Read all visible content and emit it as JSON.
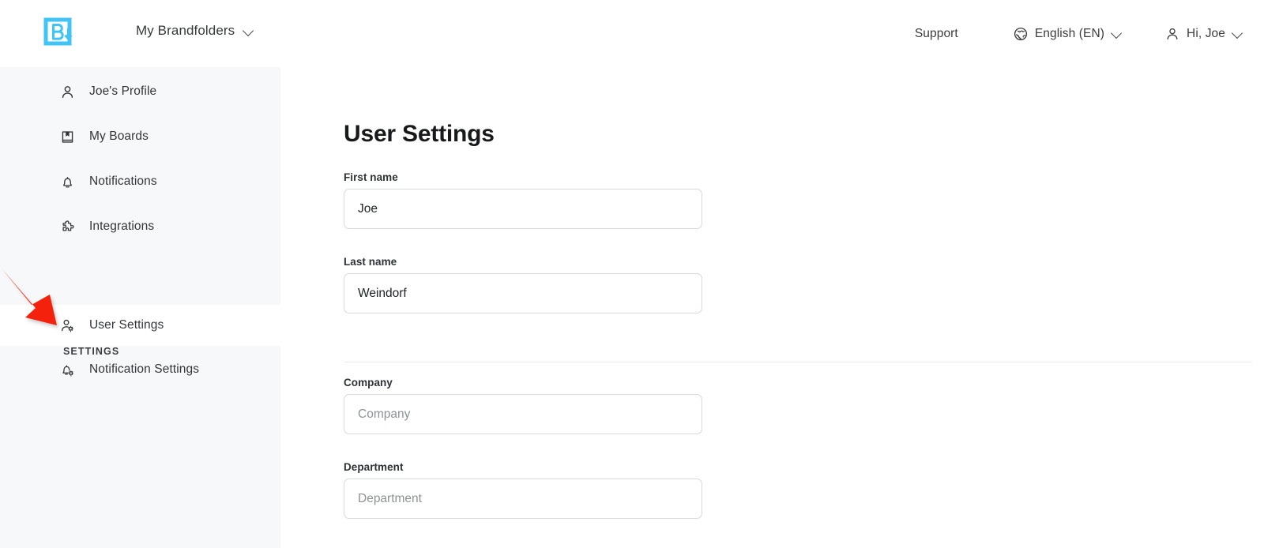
{
  "brand": {
    "logo_icon": "brandfolder-b-logo",
    "logo_color": "#40c4f5"
  },
  "header": {
    "brandfolders_label": "My Brandfolders",
    "brandfolders_caret_icon": "chevron-down-icon",
    "support_label": "Support",
    "language_icon": "globe-icon",
    "language_label": "English (EN)",
    "language_caret_icon": "chevron-down-icon",
    "user_icon": "person-icon",
    "user_label": "Hi, Joe",
    "user_caret_icon": "chevron-down-icon"
  },
  "sidebar": {
    "items": [
      {
        "label": "Joe's Profile",
        "icon": "person-icon",
        "active": false
      },
      {
        "label": "My Boards",
        "icon": "book-bookmark-icon",
        "active": false
      },
      {
        "label": "Notifications",
        "icon": "bell-icon",
        "active": false
      },
      {
        "label": "Integrations",
        "icon": "puzzle-piece-icon",
        "active": false
      }
    ],
    "section_label": "SETTINGS",
    "settings_items": [
      {
        "label": "User Settings",
        "icon": "person-gear-icon",
        "active": true
      },
      {
        "label": "Notification Settings",
        "icon": "bell-gear-icon",
        "active": false
      }
    ],
    "background_color": "#f7f8fa",
    "active_background_color": "#ffffff"
  },
  "main": {
    "page_title": "User Settings",
    "fields": [
      {
        "label": "First name",
        "value": "Joe",
        "placeholder": "",
        "is_placeholder": false
      },
      {
        "label": "Last name",
        "value": "Weindorf",
        "placeholder": "",
        "is_placeholder": false
      },
      {
        "label": "Company",
        "value": "",
        "placeholder": "Company",
        "is_placeholder": true
      },
      {
        "label": "Department",
        "value": "",
        "placeholder": "Department",
        "is_placeholder": true
      }
    ]
  },
  "annotation": {
    "arrow_icon": "red-arrow-pointing-to-user-settings",
    "arrow_color": "#f42209"
  }
}
